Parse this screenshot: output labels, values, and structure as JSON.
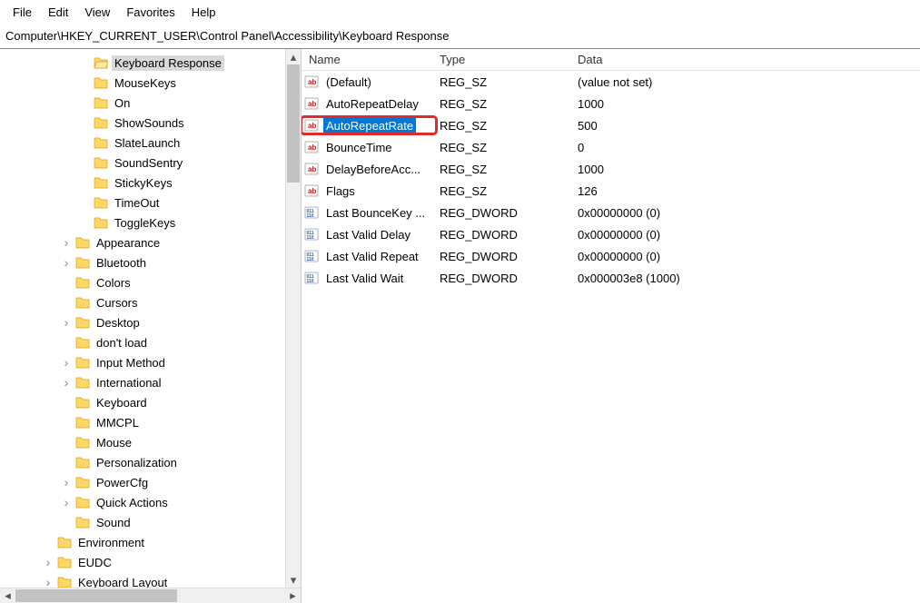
{
  "menubar": [
    "File",
    "Edit",
    "View",
    "Favorites",
    "Help"
  ],
  "address": "Computer\\HKEY_CURRENT_USER\\Control Panel\\Accessibility\\Keyboard Response",
  "tree": {
    "selected": "Keyboard Response",
    "items": [
      {
        "label": "Keyboard Response",
        "indent": 4,
        "exp": "",
        "selected": true
      },
      {
        "label": "MouseKeys",
        "indent": 4,
        "exp": ""
      },
      {
        "label": "On",
        "indent": 4,
        "exp": ""
      },
      {
        "label": "ShowSounds",
        "indent": 4,
        "exp": ""
      },
      {
        "label": "SlateLaunch",
        "indent": 4,
        "exp": ""
      },
      {
        "label": "SoundSentry",
        "indent": 4,
        "exp": ""
      },
      {
        "label": "StickyKeys",
        "indent": 4,
        "exp": ""
      },
      {
        "label": "TimeOut",
        "indent": 4,
        "exp": ""
      },
      {
        "label": "ToggleKeys",
        "indent": 4,
        "exp": ""
      },
      {
        "label": "Appearance",
        "indent": 3,
        "exp": ">"
      },
      {
        "label": "Bluetooth",
        "indent": 3,
        "exp": ">"
      },
      {
        "label": "Colors",
        "indent": 3,
        "exp": ""
      },
      {
        "label": "Cursors",
        "indent": 3,
        "exp": ""
      },
      {
        "label": "Desktop",
        "indent": 3,
        "exp": ">"
      },
      {
        "label": "don't load",
        "indent": 3,
        "exp": ""
      },
      {
        "label": "Input Method",
        "indent": 3,
        "exp": ">"
      },
      {
        "label": "International",
        "indent": 3,
        "exp": ">"
      },
      {
        "label": "Keyboard",
        "indent": 3,
        "exp": ""
      },
      {
        "label": "MMCPL",
        "indent": 3,
        "exp": ""
      },
      {
        "label": "Mouse",
        "indent": 3,
        "exp": ""
      },
      {
        "label": "Personalization",
        "indent": 3,
        "exp": ""
      },
      {
        "label": "PowerCfg",
        "indent": 3,
        "exp": ">"
      },
      {
        "label": "Quick Actions",
        "indent": 3,
        "exp": ">"
      },
      {
        "label": "Sound",
        "indent": 3,
        "exp": ""
      },
      {
        "label": "Environment",
        "indent": 2,
        "exp": ""
      },
      {
        "label": "EUDC",
        "indent": 2,
        "exp": ">"
      },
      {
        "label": "Keyboard Layout",
        "indent": 2,
        "exp": ">"
      }
    ]
  },
  "columns": {
    "name": "Name",
    "type": "Type",
    "data": "Data"
  },
  "values": [
    {
      "name": "(Default)",
      "type": "REG_SZ",
      "data": "(value not set)",
      "kind": "sz"
    },
    {
      "name": "AutoRepeatDelay",
      "type": "REG_SZ",
      "data": "1000",
      "kind": "sz"
    },
    {
      "name": "AutoRepeatRate",
      "type": "REG_SZ",
      "data": "500",
      "kind": "sz",
      "selected": true,
      "highlighted": true
    },
    {
      "name": "BounceTime",
      "type": "REG_SZ",
      "data": "0",
      "kind": "sz"
    },
    {
      "name": "DelayBeforeAcc...",
      "type": "REG_SZ",
      "data": "1000",
      "kind": "sz"
    },
    {
      "name": "Flags",
      "type": "REG_SZ",
      "data": "126",
      "kind": "sz"
    },
    {
      "name": "Last BounceKey ...",
      "type": "REG_DWORD",
      "data": "0x00000000 (0)",
      "kind": "dw"
    },
    {
      "name": "Last Valid Delay",
      "type": "REG_DWORD",
      "data": "0x00000000 (0)",
      "kind": "dw"
    },
    {
      "name": "Last Valid Repeat",
      "type": "REG_DWORD",
      "data": "0x00000000 (0)",
      "kind": "dw"
    },
    {
      "name": "Last Valid Wait",
      "type": "REG_DWORD",
      "data": "0x000003e8 (1000)",
      "kind": "dw"
    }
  ]
}
